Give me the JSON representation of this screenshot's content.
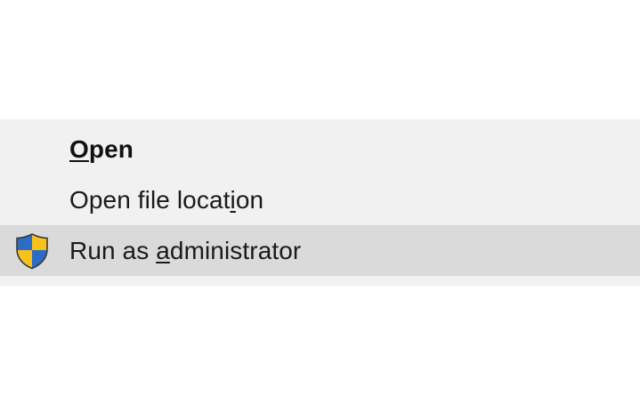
{
  "menu": {
    "items": [
      {
        "pre": "",
        "mnemonic": "O",
        "post": "pen",
        "default": true,
        "highlighted": false,
        "icon": ""
      },
      {
        "pre": "Open file locat",
        "mnemonic": "i",
        "post": "on",
        "default": false,
        "highlighted": false,
        "icon": ""
      },
      {
        "pre": "Run as ",
        "mnemonic": "a",
        "post": "dministrator",
        "default": false,
        "highlighted": true,
        "icon": "uac-shield-icon"
      }
    ]
  },
  "colors": {
    "menu_background": "#f1f1f1",
    "highlight_background": "#dadada",
    "shield_blue": "#2b6cc4",
    "shield_yellow": "#f7c21b"
  }
}
